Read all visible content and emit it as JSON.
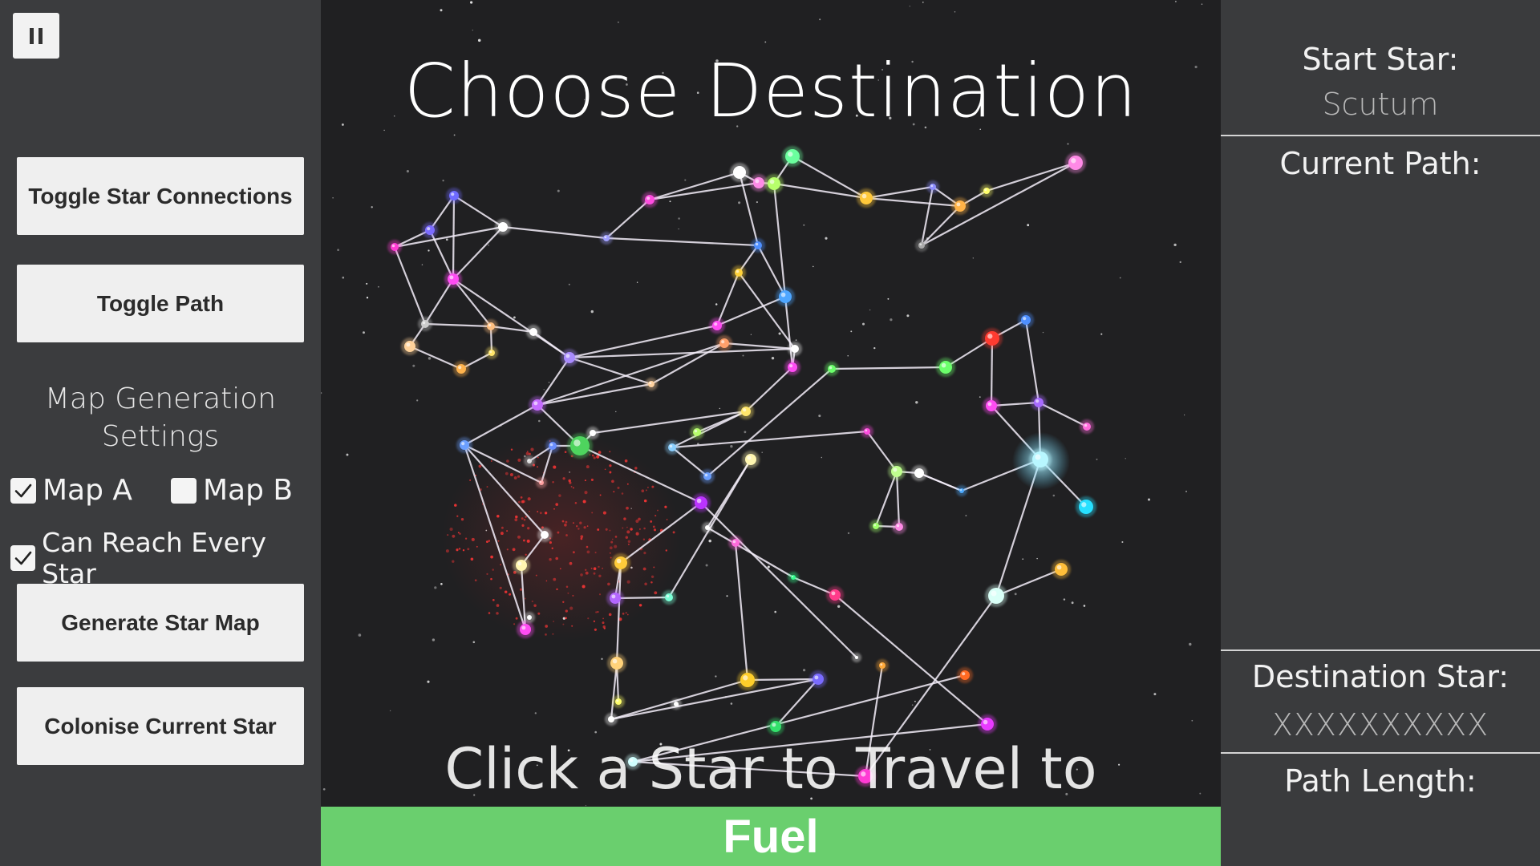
{
  "left_panel": {
    "pause_icon": "pause-icon",
    "toggle_connections_label": "Toggle Star Connections",
    "toggle_path_label": "Toggle Path",
    "settings_heading_line1": "Map Generation",
    "settings_heading_line2": "Settings",
    "map_a": {
      "label": "Map A",
      "checked": true
    },
    "map_b": {
      "label": "Map B",
      "checked": false
    },
    "reach_every_star": {
      "label": "Can Reach Every Star",
      "checked": true
    },
    "generate_label": "Generate Star Map",
    "colonise_label": "Colonise Current Star"
  },
  "viewport": {
    "title": "Choose Destination",
    "hint": "Click a Star to Travel to",
    "fuel_label": "Fuel",
    "fuel_level": 1.0
  },
  "right_panel": {
    "start_star_label": "Start Star:",
    "start_star_value": "Scutum",
    "current_path_label": "Current Path:",
    "destination_star_label": "Destination Star:",
    "destination_star_value": "XXXXXXXXXX",
    "path_length_label": "Path Length:"
  },
  "colors": {
    "panel_bg": "#3a3b3d",
    "space_bg": "#202022",
    "fuel_green": "#6acf6e",
    "button_bg": "#efefef"
  }
}
